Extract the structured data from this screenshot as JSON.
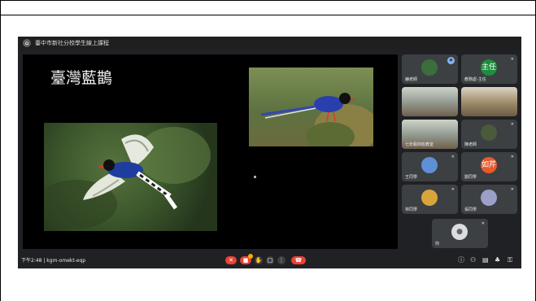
{
  "window": {
    "title": "臺中市新社分校學生線上課程"
  },
  "slide": {
    "title": "臺灣藍鵲"
  },
  "participants": [
    {
      "name": "鐘老師",
      "avatar": "",
      "color": "#3c6e3c",
      "kind": "video",
      "highlight": "true"
    },
    {
      "name": "教務處-主任",
      "avatar": "主任",
      "color": "#1e8e3e",
      "kind": "avatar"
    },
    {
      "name": "",
      "avatar": "",
      "color": "",
      "kind": "class"
    },
    {
      "name": "",
      "avatar": "",
      "color": "",
      "kind": "class2"
    },
    {
      "name": "七年級四班教室",
      "avatar": "",
      "color": "",
      "kind": "class"
    },
    {
      "name": "陳老師",
      "avatar": "",
      "color": "#4a5a3a",
      "kind": "video"
    },
    {
      "name": "王同學",
      "avatar": "",
      "color": "#5f8fd6",
      "kind": "avatar"
    },
    {
      "name": "劉同學",
      "avatar": "如芹",
      "color": "#e8592b",
      "kind": "avatar"
    },
    {
      "name": "林同學",
      "avatar": "",
      "color": "#d9a53a",
      "kind": "avatar"
    },
    {
      "name": "張同學",
      "avatar": "",
      "color": "#9aa0c8",
      "kind": "avatar"
    },
    {
      "name": "你",
      "avatar": "",
      "color": "#dadce0",
      "kind": "self"
    }
  ],
  "bottombar": {
    "time_code": "下午2:48 | kgm-omekt-eqp",
    "controls": [
      "mic-off",
      "camera-off",
      "hand",
      "present",
      "more",
      "end-call"
    ],
    "right_icons": [
      "info",
      "people",
      "chat",
      "activities",
      "lock"
    ]
  }
}
